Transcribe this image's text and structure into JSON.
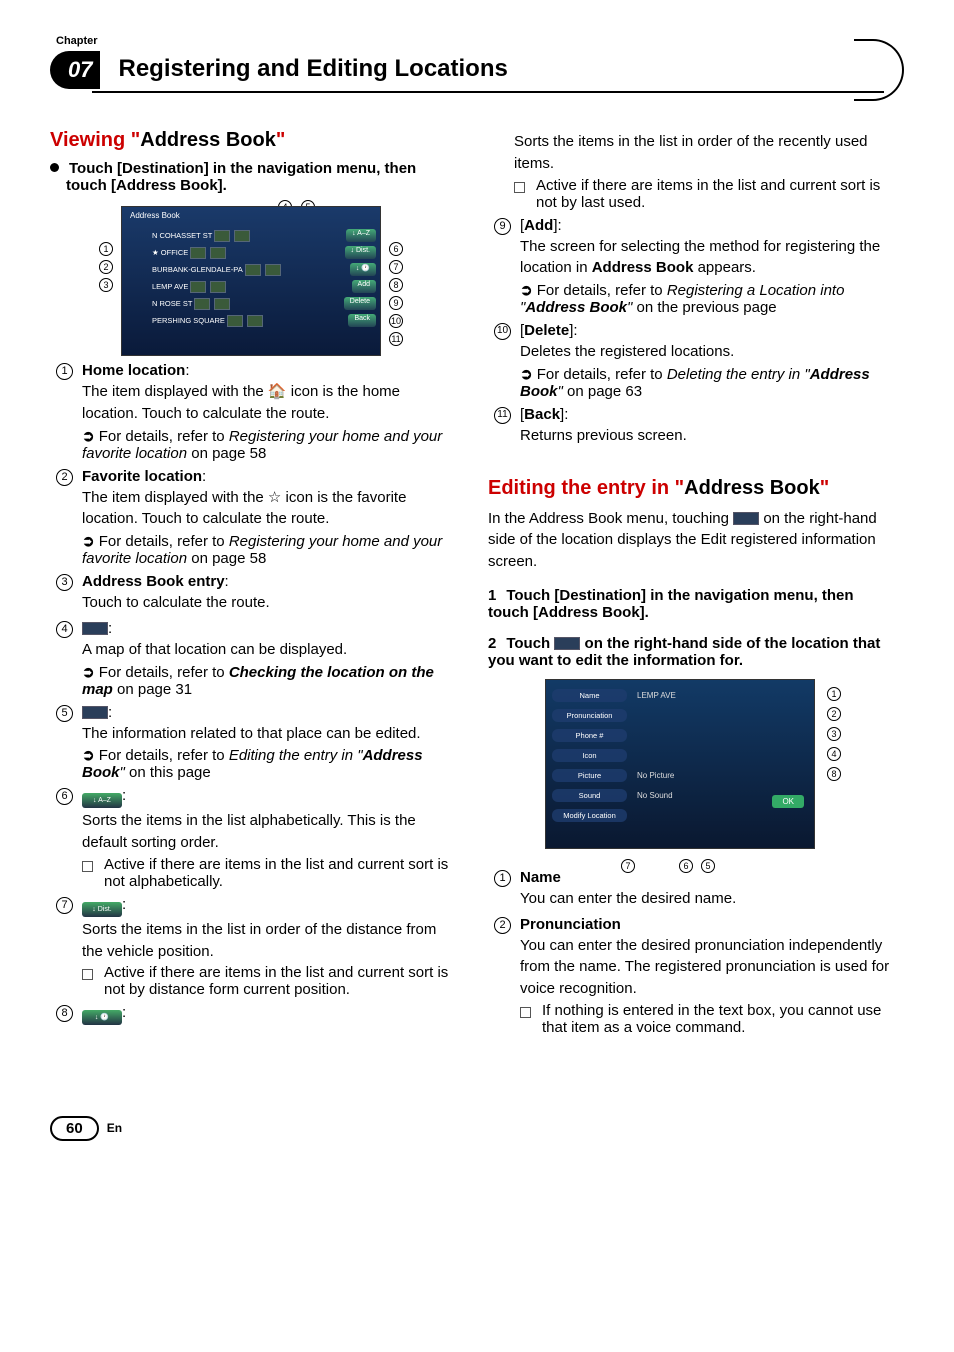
{
  "header": {
    "chapterLabel": "Chapter",
    "chapterNum": "07",
    "title": "Registering and Editing Locations"
  },
  "col1": {
    "sectionTitle": {
      "red": "Viewing \"",
      "black": "Address Book",
      "red2": "\""
    },
    "instr": "Touch [Destination] in the navigation menu, then touch [Address Book].",
    "screen": {
      "title": "Address Book",
      "rows": [
        {
          "label": "N COHASSET ST"
        },
        {
          "label": "★ OFFICE"
        },
        {
          "label": "BURBANK-GLENDALE-PA"
        },
        {
          "label": "LEMP AVE"
        },
        {
          "label": "N ROSE ST"
        },
        {
          "label": "PERSHING SQUARE"
        }
      ],
      "buttons": {
        "az": "A–Z",
        "dist": "Dist.",
        "clock": "",
        "add": "Add",
        "del": "Delete",
        "back": "Back"
      }
    },
    "items": [
      {
        "num": "1",
        "title": "Home location",
        "colon": ":",
        "body": "The item displayed with the 🏠 icon is the home location. Touch to calculate the route.",
        "link": {
          "pre": "For details, refer to ",
          "it": "Registering your home and your favorite location",
          "suf": " on page 58"
        }
      },
      {
        "num": "2",
        "title": "Favorite location",
        "colon": ":",
        "body": "The item displayed with the ☆ icon is the favorite location. Touch to calculate the route.",
        "link": {
          "pre": "For details, refer to ",
          "it": "Registering your home and your favorite location",
          "suf": " on page 58"
        }
      },
      {
        "num": "3",
        "title": "Address Book entry",
        "colon": ":",
        "body": "Touch to calculate the route."
      },
      {
        "num": "4",
        "icon": "map",
        "colon": ":",
        "body": "A map of that location can be displayed.",
        "link": {
          "pre": "For details, refer to ",
          "boldit": "Checking the location on the map",
          "suf": " on page 31"
        }
      },
      {
        "num": "5",
        "icon": "edit",
        "colon": ":",
        "body": "The information related to that place can be edited.",
        "link": {
          "pre": "For details, refer to ",
          "it": "Editing the entry in ",
          "qb": "Address Book",
          "q2": "\"",
          "suf": " on this page"
        }
      },
      {
        "num": "6",
        "btn": "A–Z",
        "colon": ":",
        "body": "Sorts the items in the list alphabetically. This is the default sorting order.",
        "note": "Active if there are items in the list and current sort is not alphabetically."
      },
      {
        "num": "7",
        "btn": "Dist.",
        "colon": ":",
        "body": "Sorts the items in the list in order of the distance from the vehicle position.",
        "note": "Active if there are items in the list and current sort is not by distance form current position."
      },
      {
        "num": "8",
        "btn": "",
        "colon": ":"
      }
    ]
  },
  "col2": {
    "topCont": {
      "body": "Sorts the items in the list in order of the recently used items.",
      "note": "Active if there are items in the list and current sort is not by last used."
    },
    "items": [
      {
        "num": "9",
        "bracket": "Add",
        "colon": ":",
        "body": "The screen for selecting the method for registering the location in ",
        "bodyBold": "Address Book",
        "bodyAfter": " appears.",
        "link": {
          "pre": "For details, refer to ",
          "it": "Registering a Location into ",
          "qb": "Address Book",
          "q2": "\"",
          "suf": " on the previous page"
        }
      },
      {
        "num": "10",
        "bracket": "Delete",
        "colon": ":",
        "body": "Deletes the registered locations.",
        "link": {
          "pre": "For details, refer to ",
          "it": "Deleting the entry in ",
          "qb": "Address Book",
          "q2": "\"",
          "suf": " on page 63"
        }
      },
      {
        "num": "11",
        "bracket": "Back",
        "colon": ":",
        "body": "Returns previous screen."
      }
    ],
    "section2": {
      "red": "Editing the entry in \"",
      "black": "Address Book",
      "red2": "\""
    },
    "intro": {
      "p1": "In the Address Book menu, touching ",
      "p2": " on the right-hand side of the location displays the Edit registered information screen."
    },
    "step1": {
      "num": "1",
      "text": "Touch [Destination] in the navigation menu, then touch [Address Book]."
    },
    "step2": {
      "num": "2",
      "pre": "Touch ",
      "post": " on the right-hand side of the location that you want to edit the information for."
    },
    "editScreen": {
      "rows": [
        {
          "label": "Name",
          "val": "LEMP AVE"
        },
        {
          "label": "Pronunciation",
          "val": ""
        },
        {
          "label": "Phone #",
          "val": ""
        },
        {
          "label": "Icon",
          "val": ""
        },
        {
          "label": "Picture",
          "val": "No Picture"
        },
        {
          "label": "Sound",
          "val": "No Sound"
        },
        {
          "label": "Modify Location",
          "val": ""
        }
      ],
      "ok": "OK"
    },
    "editItems": [
      {
        "num": "1",
        "title": "Name",
        "body": "You can enter the desired name."
      },
      {
        "num": "2",
        "title": "Pronunciation",
        "body": "You can enter the desired pronunciation independently from the name. The registered pronunciation is used for voice recognition.",
        "note": "If nothing is entered in the text box, you cannot use that item as a voice command."
      }
    ]
  },
  "footer": {
    "page": "60",
    "lang": "En"
  }
}
